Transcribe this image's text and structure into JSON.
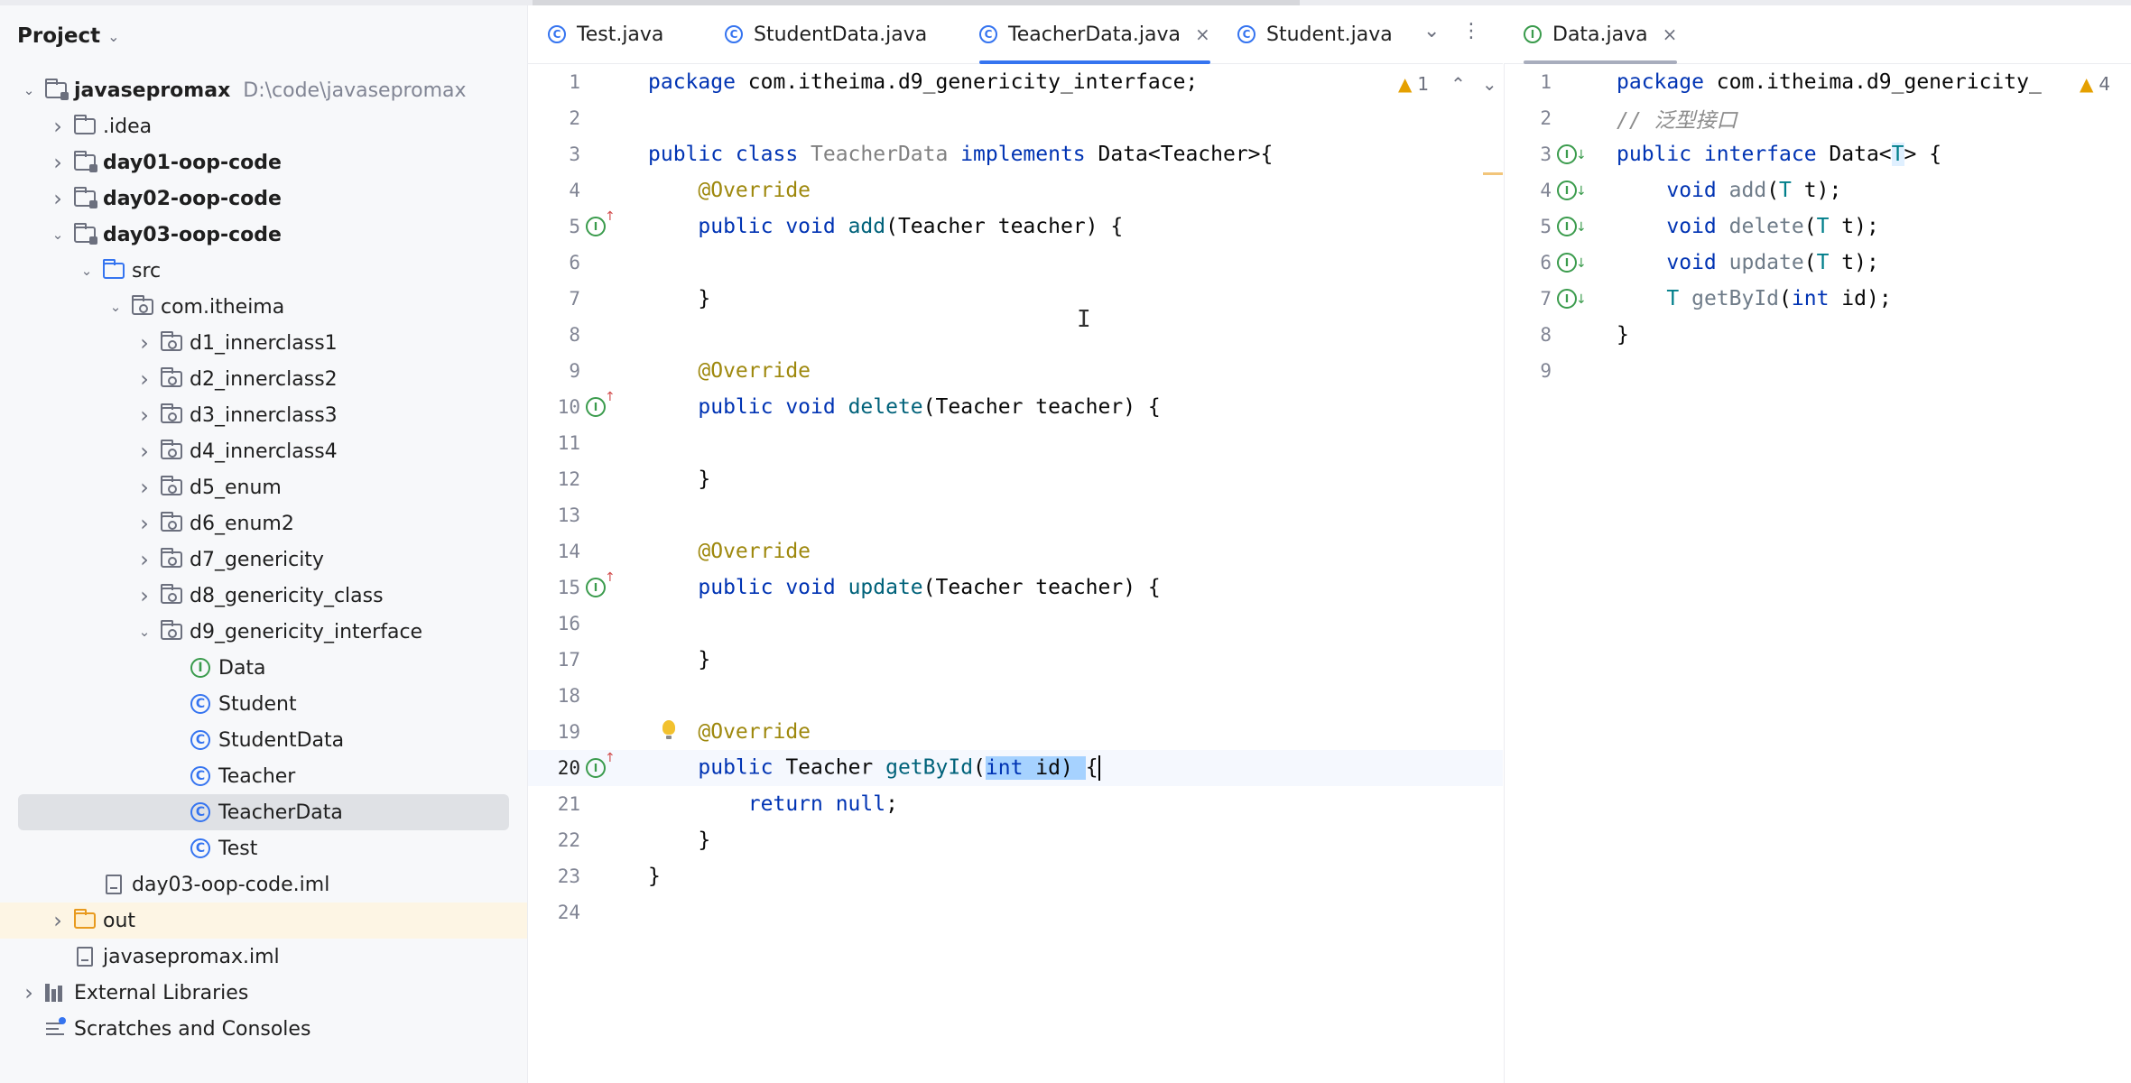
{
  "project": {
    "title": "Project",
    "tree": [
      {
        "label": "javasepromax",
        "path": "D:\\code\\javasepromax",
        "depth": 0,
        "toggle": "open",
        "icon": "module-folder-icon",
        "bold": true
      },
      {
        "label": ".idea",
        "depth": 1,
        "toggle": "closed",
        "icon": "folder-icon"
      },
      {
        "label": "day01-oop-code",
        "depth": 1,
        "toggle": "closed",
        "icon": "module-folder-icon",
        "bold": true
      },
      {
        "label": "day02-oop-code",
        "depth": 1,
        "toggle": "closed",
        "icon": "module-folder-icon",
        "bold": true
      },
      {
        "label": "day03-oop-code",
        "depth": 1,
        "toggle": "open",
        "icon": "module-folder-icon",
        "bold": true
      },
      {
        "label": "src",
        "depth": 2,
        "toggle": "open",
        "icon": "source-folder-icon"
      },
      {
        "label": "com.itheima",
        "depth": 3,
        "toggle": "open",
        "icon": "package-icon"
      },
      {
        "label": "d1_innerclass1",
        "depth": 4,
        "toggle": "closed",
        "icon": "package-icon"
      },
      {
        "label": "d2_innerclass2",
        "depth": 4,
        "toggle": "closed",
        "icon": "package-icon"
      },
      {
        "label": "d3_innerclass3",
        "depth": 4,
        "toggle": "closed",
        "icon": "package-icon"
      },
      {
        "label": "d4_innerclass4",
        "depth": 4,
        "toggle": "closed",
        "icon": "package-icon"
      },
      {
        "label": "d5_enum",
        "depth": 4,
        "toggle": "closed",
        "icon": "package-icon"
      },
      {
        "label": "d6_enum2",
        "depth": 4,
        "toggle": "closed",
        "icon": "package-icon"
      },
      {
        "label": "d7_genericity",
        "depth": 4,
        "toggle": "closed",
        "icon": "package-icon"
      },
      {
        "label": "d8_genericity_class",
        "depth": 4,
        "toggle": "closed",
        "icon": "package-icon"
      },
      {
        "label": "d9_genericity_interface",
        "depth": 4,
        "toggle": "open",
        "icon": "package-icon"
      },
      {
        "label": "Data",
        "depth": 5,
        "toggle": "none",
        "icon": "interface-icon"
      },
      {
        "label": "Student",
        "depth": 5,
        "toggle": "none",
        "icon": "class-icon"
      },
      {
        "label": "StudentData",
        "depth": 5,
        "toggle": "none",
        "icon": "class-icon"
      },
      {
        "label": "Teacher",
        "depth": 5,
        "toggle": "none",
        "icon": "class-icon"
      },
      {
        "label": "TeacherData",
        "depth": 5,
        "toggle": "none",
        "icon": "class-icon",
        "selected": true
      },
      {
        "label": "Test",
        "depth": 5,
        "toggle": "none",
        "icon": "class-icon"
      },
      {
        "label": "day03-oop-code.iml",
        "depth": 2,
        "toggle": "none",
        "icon": "file-icon"
      },
      {
        "label": "out",
        "depth": 1,
        "toggle": "closed",
        "icon": "excluded-folder-icon",
        "highlight": true
      },
      {
        "label": "javasepromax.iml",
        "depth": 1,
        "toggle": "none",
        "icon": "file-icon"
      },
      {
        "label": "External Libraries",
        "depth": 0,
        "toggle": "closed",
        "icon": "libraries-icon"
      },
      {
        "label": "Scratches and Consoles",
        "depth": 0,
        "toggle": "none",
        "icon": "scratches-icon"
      }
    ]
  },
  "left_tabs": [
    {
      "label": "Test.java",
      "icon": "C",
      "active": false
    },
    {
      "label": "StudentData.java",
      "icon": "C",
      "active": false
    },
    {
      "label": "TeacherData.java",
      "icon": "C",
      "active": true,
      "closable": true
    },
    {
      "label": "Student.java",
      "icon": "C",
      "active": false
    }
  ],
  "right_tabs": [
    {
      "label": "Data.java",
      "icon": "I",
      "active": true,
      "closable": true
    }
  ],
  "left_editor": {
    "warning_count": "1",
    "current_line": 20,
    "gutter": [
      {
        "line": 5,
        "marker": "implements"
      },
      {
        "line": 10,
        "marker": "implements"
      },
      {
        "line": 15,
        "marker": "implements"
      },
      {
        "line": 19,
        "marker": "bulb"
      },
      {
        "line": 20,
        "marker": "implements"
      }
    ],
    "lines": [
      [
        [
          "kw",
          "package "
        ],
        [
          "t",
          "com.itheima.d9_genericity_interface;"
        ]
      ],
      [],
      [
        [
          "kw",
          "public class "
        ],
        [
          "clsdim",
          "TeacherData "
        ],
        [
          "kw",
          "implements "
        ],
        [
          "t",
          "Data<Teacher>{"
        ]
      ],
      [
        [
          "t",
          "    "
        ],
        [
          "ann",
          "@Override"
        ]
      ],
      [
        [
          "t",
          "    "
        ],
        [
          "kw",
          "public void "
        ],
        [
          "fn",
          "add"
        ],
        [
          "t",
          "(Teacher teacher) {"
        ]
      ],
      [],
      [
        [
          "t",
          "    }"
        ]
      ],
      [],
      [
        [
          "t",
          "    "
        ],
        [
          "ann",
          "@Override"
        ]
      ],
      [
        [
          "t",
          "    "
        ],
        [
          "kw",
          "public void "
        ],
        [
          "fn",
          "delete"
        ],
        [
          "t",
          "(Teacher teacher) {"
        ]
      ],
      [],
      [
        [
          "t",
          "    }"
        ]
      ],
      [],
      [
        [
          "t",
          "    "
        ],
        [
          "ann",
          "@Override"
        ]
      ],
      [
        [
          "t",
          "    "
        ],
        [
          "kw",
          "public void "
        ],
        [
          "fn",
          "update"
        ],
        [
          "t",
          "(Teacher teacher) {"
        ]
      ],
      [],
      [
        [
          "t",
          "    }"
        ]
      ],
      [],
      [
        [
          "t",
          "    "
        ],
        [
          "ann",
          "@Override"
        ]
      ],
      [
        [
          "t",
          "    "
        ],
        [
          "kw",
          "public "
        ],
        [
          "t",
          "Teacher "
        ],
        [
          "fn",
          "getById"
        ],
        [
          "t",
          "("
        ],
        [
          "hlkw",
          "int"
        ],
        [
          "hl",
          " id) "
        ],
        [
          "t",
          "{"
        ],
        [
          "caret",
          ""
        ]
      ],
      [
        [
          "t",
          "        "
        ],
        [
          "kw",
          "return null"
        ],
        [
          "t",
          ";"
        ]
      ],
      [
        [
          "t",
          "    }"
        ]
      ],
      [
        [
          "t",
          "}"
        ]
      ],
      []
    ]
  },
  "right_editor": {
    "warning_count": "4",
    "gutter": [
      3,
      4,
      5,
      6,
      7
    ],
    "lines": [
      [
        [
          "kw",
          "package "
        ],
        [
          "t",
          "com.itheima.d9_genericity_"
        ]
      ],
      [
        [
          "cmt",
          "// 泛型接口"
        ]
      ],
      [
        [
          "kw",
          "public interface "
        ],
        [
          "t",
          "Data<"
        ],
        [
          "tphl",
          "T"
        ],
        [
          "t",
          "> {"
        ]
      ],
      [
        [
          "t",
          "    "
        ],
        [
          "kw",
          "void "
        ],
        [
          "fndim",
          "add"
        ],
        [
          "t",
          "("
        ],
        [
          "tp",
          "T"
        ],
        [
          "t",
          " t);"
        ]
      ],
      [
        [
          "t",
          "    "
        ],
        [
          "kw",
          "void "
        ],
        [
          "fndim",
          "delete"
        ],
        [
          "t",
          "("
        ],
        [
          "tp",
          "T"
        ],
        [
          "t",
          " t);"
        ]
      ],
      [
        [
          "t",
          "    "
        ],
        [
          "kw",
          "void "
        ],
        [
          "fndim",
          "update"
        ],
        [
          "t",
          "("
        ],
        [
          "tp",
          "T"
        ],
        [
          "t",
          " t);"
        ]
      ],
      [
        [
          "t",
          "    "
        ],
        [
          "tp",
          "T "
        ],
        [
          "fndim",
          "getById"
        ],
        [
          "t",
          "("
        ],
        [
          "kw",
          "int"
        ],
        [
          "t",
          " id);"
        ]
      ],
      [
        [
          "t",
          "}"
        ]
      ],
      []
    ]
  },
  "colors": {
    "accent": "#3574f0",
    "interface_green": "#3a9b4c",
    "keyword": "#0033b3",
    "annotation": "#9e880d",
    "selection": "#a6d2ff"
  }
}
